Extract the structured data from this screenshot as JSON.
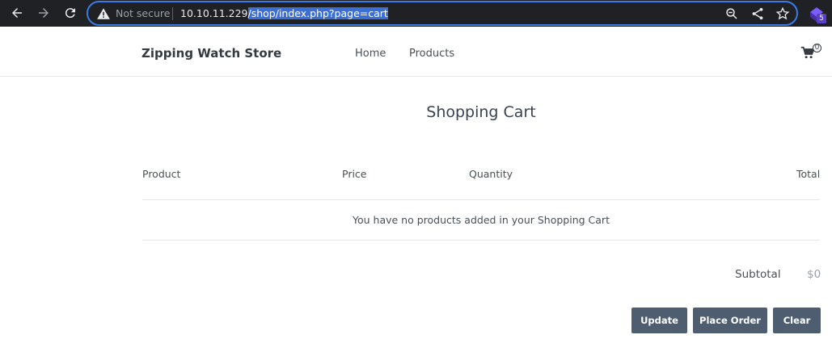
{
  "browser": {
    "security_text": "Not secure",
    "url_host": "10.10.11.229",
    "url_path": "/shop/index.php?page=cart",
    "extension_badge": "5"
  },
  "header": {
    "brand": "Zipping Watch Store",
    "nav": [
      {
        "label": "Home"
      },
      {
        "label": "Products"
      }
    ],
    "cart_count": "0"
  },
  "cart": {
    "title": "Shopping Cart",
    "columns": [
      "Product",
      "Price",
      "Quantity",
      "Total"
    ],
    "empty_message": "You have no products added in your Shopping Cart",
    "subtotal_label": "Subtotal",
    "subtotal_value": "$0",
    "buttons": {
      "update": "Update",
      "place_order": "Place Order",
      "clear": "Clear"
    }
  },
  "colors": {
    "chrome_bg": "#202124",
    "omnibox_border": "#3b7be8",
    "button_bg": "#4e5d70"
  }
}
